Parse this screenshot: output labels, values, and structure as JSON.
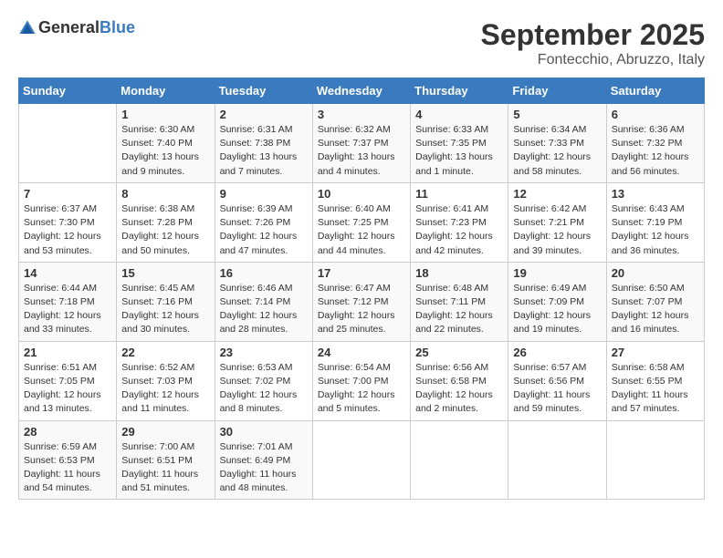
{
  "header": {
    "logo_general": "General",
    "logo_blue": "Blue",
    "month": "September 2025",
    "location": "Fontecchio, Abruzzo, Italy"
  },
  "weekdays": [
    "Sunday",
    "Monday",
    "Tuesday",
    "Wednesday",
    "Thursday",
    "Friday",
    "Saturday"
  ],
  "weeks": [
    [
      {
        "day": "",
        "info": ""
      },
      {
        "day": "1",
        "info": "Sunrise: 6:30 AM\nSunset: 7:40 PM\nDaylight: 13 hours\nand 9 minutes."
      },
      {
        "day": "2",
        "info": "Sunrise: 6:31 AM\nSunset: 7:38 PM\nDaylight: 13 hours\nand 7 minutes."
      },
      {
        "day": "3",
        "info": "Sunrise: 6:32 AM\nSunset: 7:37 PM\nDaylight: 13 hours\nand 4 minutes."
      },
      {
        "day": "4",
        "info": "Sunrise: 6:33 AM\nSunset: 7:35 PM\nDaylight: 13 hours\nand 1 minute."
      },
      {
        "day": "5",
        "info": "Sunrise: 6:34 AM\nSunset: 7:33 PM\nDaylight: 12 hours\nand 58 minutes."
      },
      {
        "day": "6",
        "info": "Sunrise: 6:36 AM\nSunset: 7:32 PM\nDaylight: 12 hours\nand 56 minutes."
      }
    ],
    [
      {
        "day": "7",
        "info": "Sunrise: 6:37 AM\nSunset: 7:30 PM\nDaylight: 12 hours\nand 53 minutes."
      },
      {
        "day": "8",
        "info": "Sunrise: 6:38 AM\nSunset: 7:28 PM\nDaylight: 12 hours\nand 50 minutes."
      },
      {
        "day": "9",
        "info": "Sunrise: 6:39 AM\nSunset: 7:26 PM\nDaylight: 12 hours\nand 47 minutes."
      },
      {
        "day": "10",
        "info": "Sunrise: 6:40 AM\nSunset: 7:25 PM\nDaylight: 12 hours\nand 44 minutes."
      },
      {
        "day": "11",
        "info": "Sunrise: 6:41 AM\nSunset: 7:23 PM\nDaylight: 12 hours\nand 42 minutes."
      },
      {
        "day": "12",
        "info": "Sunrise: 6:42 AM\nSunset: 7:21 PM\nDaylight: 12 hours\nand 39 minutes."
      },
      {
        "day": "13",
        "info": "Sunrise: 6:43 AM\nSunset: 7:19 PM\nDaylight: 12 hours\nand 36 minutes."
      }
    ],
    [
      {
        "day": "14",
        "info": "Sunrise: 6:44 AM\nSunset: 7:18 PM\nDaylight: 12 hours\nand 33 minutes."
      },
      {
        "day": "15",
        "info": "Sunrise: 6:45 AM\nSunset: 7:16 PM\nDaylight: 12 hours\nand 30 minutes."
      },
      {
        "day": "16",
        "info": "Sunrise: 6:46 AM\nSunset: 7:14 PM\nDaylight: 12 hours\nand 28 minutes."
      },
      {
        "day": "17",
        "info": "Sunrise: 6:47 AM\nSunset: 7:12 PM\nDaylight: 12 hours\nand 25 minutes."
      },
      {
        "day": "18",
        "info": "Sunrise: 6:48 AM\nSunset: 7:11 PM\nDaylight: 12 hours\nand 22 minutes."
      },
      {
        "day": "19",
        "info": "Sunrise: 6:49 AM\nSunset: 7:09 PM\nDaylight: 12 hours\nand 19 minutes."
      },
      {
        "day": "20",
        "info": "Sunrise: 6:50 AM\nSunset: 7:07 PM\nDaylight: 12 hours\nand 16 minutes."
      }
    ],
    [
      {
        "day": "21",
        "info": "Sunrise: 6:51 AM\nSunset: 7:05 PM\nDaylight: 12 hours\nand 13 minutes."
      },
      {
        "day": "22",
        "info": "Sunrise: 6:52 AM\nSunset: 7:03 PM\nDaylight: 12 hours\nand 11 minutes."
      },
      {
        "day": "23",
        "info": "Sunrise: 6:53 AM\nSunset: 7:02 PM\nDaylight: 12 hours\nand 8 minutes."
      },
      {
        "day": "24",
        "info": "Sunrise: 6:54 AM\nSunset: 7:00 PM\nDaylight: 12 hours\nand 5 minutes."
      },
      {
        "day": "25",
        "info": "Sunrise: 6:56 AM\nSunset: 6:58 PM\nDaylight: 12 hours\nand 2 minutes."
      },
      {
        "day": "26",
        "info": "Sunrise: 6:57 AM\nSunset: 6:56 PM\nDaylight: 11 hours\nand 59 minutes."
      },
      {
        "day": "27",
        "info": "Sunrise: 6:58 AM\nSunset: 6:55 PM\nDaylight: 11 hours\nand 57 minutes."
      }
    ],
    [
      {
        "day": "28",
        "info": "Sunrise: 6:59 AM\nSunset: 6:53 PM\nDaylight: 11 hours\nand 54 minutes."
      },
      {
        "day": "29",
        "info": "Sunrise: 7:00 AM\nSunset: 6:51 PM\nDaylight: 11 hours\nand 51 minutes."
      },
      {
        "day": "30",
        "info": "Sunrise: 7:01 AM\nSunset: 6:49 PM\nDaylight: 11 hours\nand 48 minutes."
      },
      {
        "day": "",
        "info": ""
      },
      {
        "day": "",
        "info": ""
      },
      {
        "day": "",
        "info": ""
      },
      {
        "day": "",
        "info": ""
      }
    ]
  ]
}
